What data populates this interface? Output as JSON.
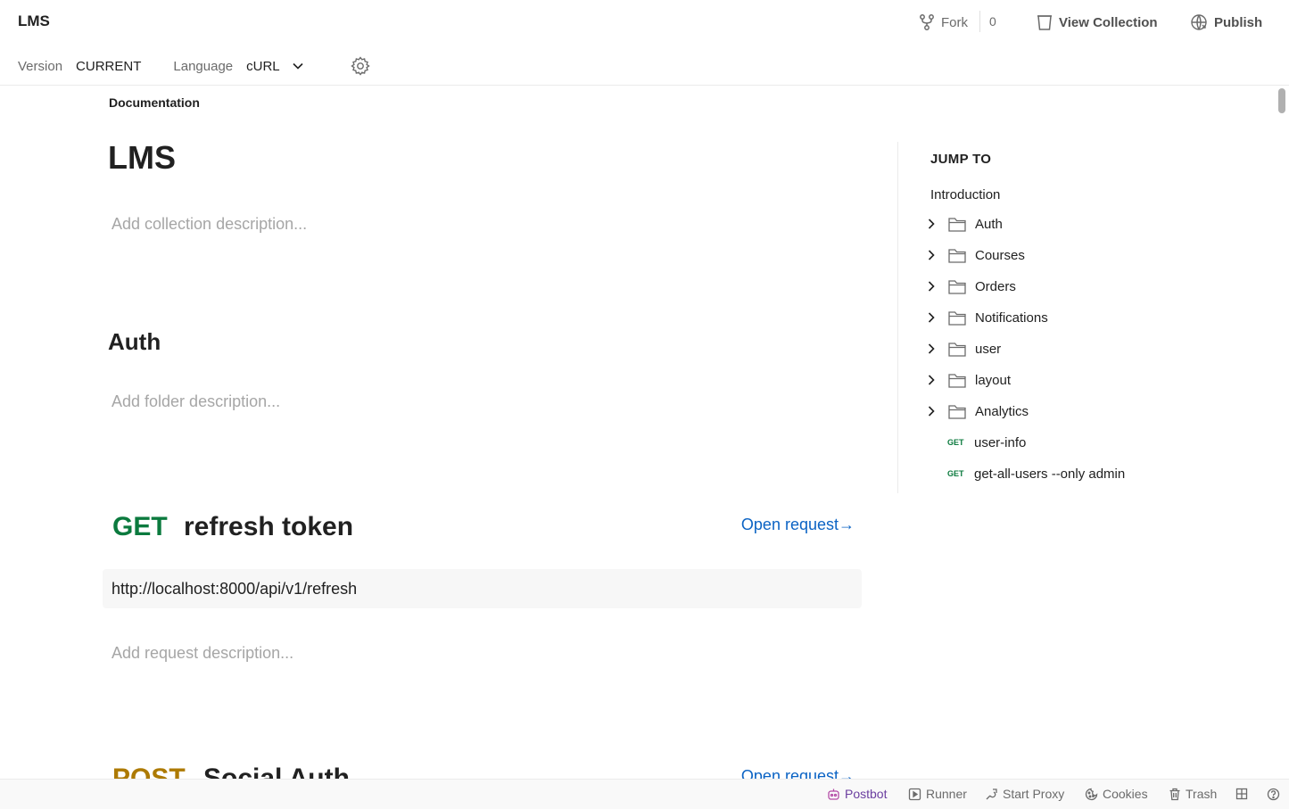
{
  "header": {
    "title": "LMS",
    "fork_label": "Fork",
    "fork_count": "0",
    "view_collection_label": "View Collection",
    "publish_label": "Publish"
  },
  "subbar": {
    "version_label": "Version",
    "version_value": "CURRENT",
    "language_label": "Language",
    "language_value": "cURL"
  },
  "doc": {
    "breadcrumb": "Documentation",
    "collection_title": "LMS",
    "collection_desc_placeholder": "Add collection description...",
    "folder_title": "Auth",
    "folder_desc_placeholder": "Add folder description...",
    "requests": [
      {
        "method": "GET",
        "method_color": "#0b7a3e",
        "name": "refresh token",
        "open_label": "Open request→",
        "url": "http://localhost:8000/api/v1/refresh",
        "desc_placeholder": "Add request description..."
      },
      {
        "method": "POST",
        "method_color": "#ad7a03",
        "name": "Social Auth",
        "open_label": "Open request→"
      }
    ]
  },
  "jump_to": {
    "title": "JUMP TO",
    "intro": "Introduction",
    "folders": [
      "Auth",
      "Courses",
      "Orders",
      "Notifications",
      "user",
      "layout",
      "Analytics"
    ],
    "requests": [
      {
        "method": "GET",
        "name": "user-info"
      },
      {
        "method": "GET",
        "name": "get-all-users --only admin"
      }
    ]
  },
  "statusbar": {
    "postbot": "Postbot",
    "runner": "Runner",
    "start_proxy": "Start Proxy",
    "cookies": "Cookies",
    "trash": "Trash",
    "accent": "#6b3fa0"
  },
  "icons": [
    "fork-icon",
    "view-collection-icon",
    "publish-icon",
    "chevron-down-icon",
    "gear-icon",
    "chevron-right-icon",
    "folder-icon",
    "postbot-icon",
    "runner-icon",
    "proxy-icon",
    "cookies-icon",
    "trash-icon",
    "layout-icon",
    "help-icon"
  ]
}
